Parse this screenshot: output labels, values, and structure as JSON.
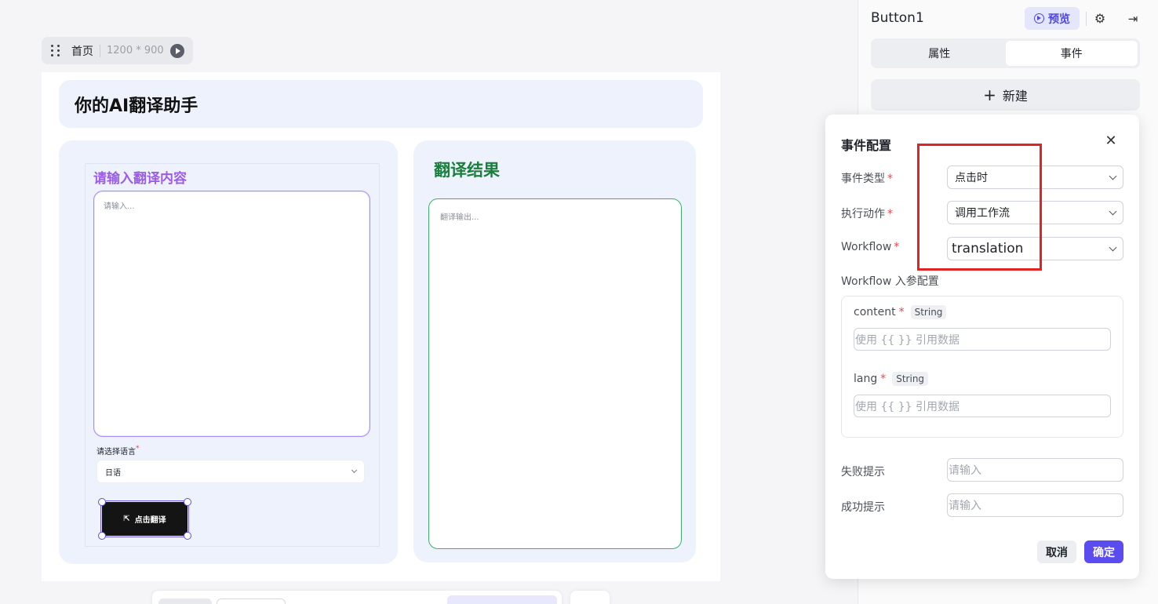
{
  "canvas": {
    "page_name": "首页",
    "page_size": "1200 * 900"
  },
  "app_preview": {
    "title": "你的AI翻译助手",
    "input_card": {
      "heading": "请输入翻译内容",
      "textarea_placeholder": "请输入...",
      "language_label": "请选择语言",
      "language_required_mark": "*",
      "language_value": "日语",
      "button_label": "点击翻译"
    },
    "result_card": {
      "heading": "翻译结果",
      "output_placeholder": "翻译输出..."
    }
  },
  "right_panel": {
    "component_name": "Button1",
    "preview_label": "预览",
    "tabs": [
      {
        "label": "属性",
        "active": false
      },
      {
        "label": "事件",
        "active": true
      }
    ],
    "new_button_label": "新建"
  },
  "event_config": {
    "title": "事件配置",
    "required_mark": "*",
    "event_type": {
      "label": "事件类型",
      "value": "点击时"
    },
    "action": {
      "label": "执行动作",
      "value": "调用工作流"
    },
    "workflow": {
      "label": "Workflow",
      "value": "translation"
    },
    "params_section_label": "Workflow 入参配置",
    "params": [
      {
        "name": "content",
        "type": "String",
        "placeholder": "使用 {{ }} 引用数据"
      },
      {
        "name": "lang",
        "type": "String",
        "placeholder": "使用 {{ }} 引用数据"
      }
    ],
    "fail_tip": {
      "label": "失败提示",
      "placeholder": "请输入"
    },
    "success_tip": {
      "label": "成功提示",
      "placeholder": "请输入"
    },
    "cancel_label": "取消",
    "confirm_label": "确定"
  },
  "colors": {
    "accent": "#5b4cf0",
    "highlight_border": "#e02424",
    "input_heading": "#9b5de5",
    "result_heading": "#1a7f3c"
  },
  "icons": [
    "drag-handle-icon",
    "play-icon",
    "cursor-icon",
    "preview-play-icon",
    "gear-icon",
    "collapse-panel-icon",
    "plus-icon",
    "close-icon",
    "chevron-down-icon"
  ]
}
